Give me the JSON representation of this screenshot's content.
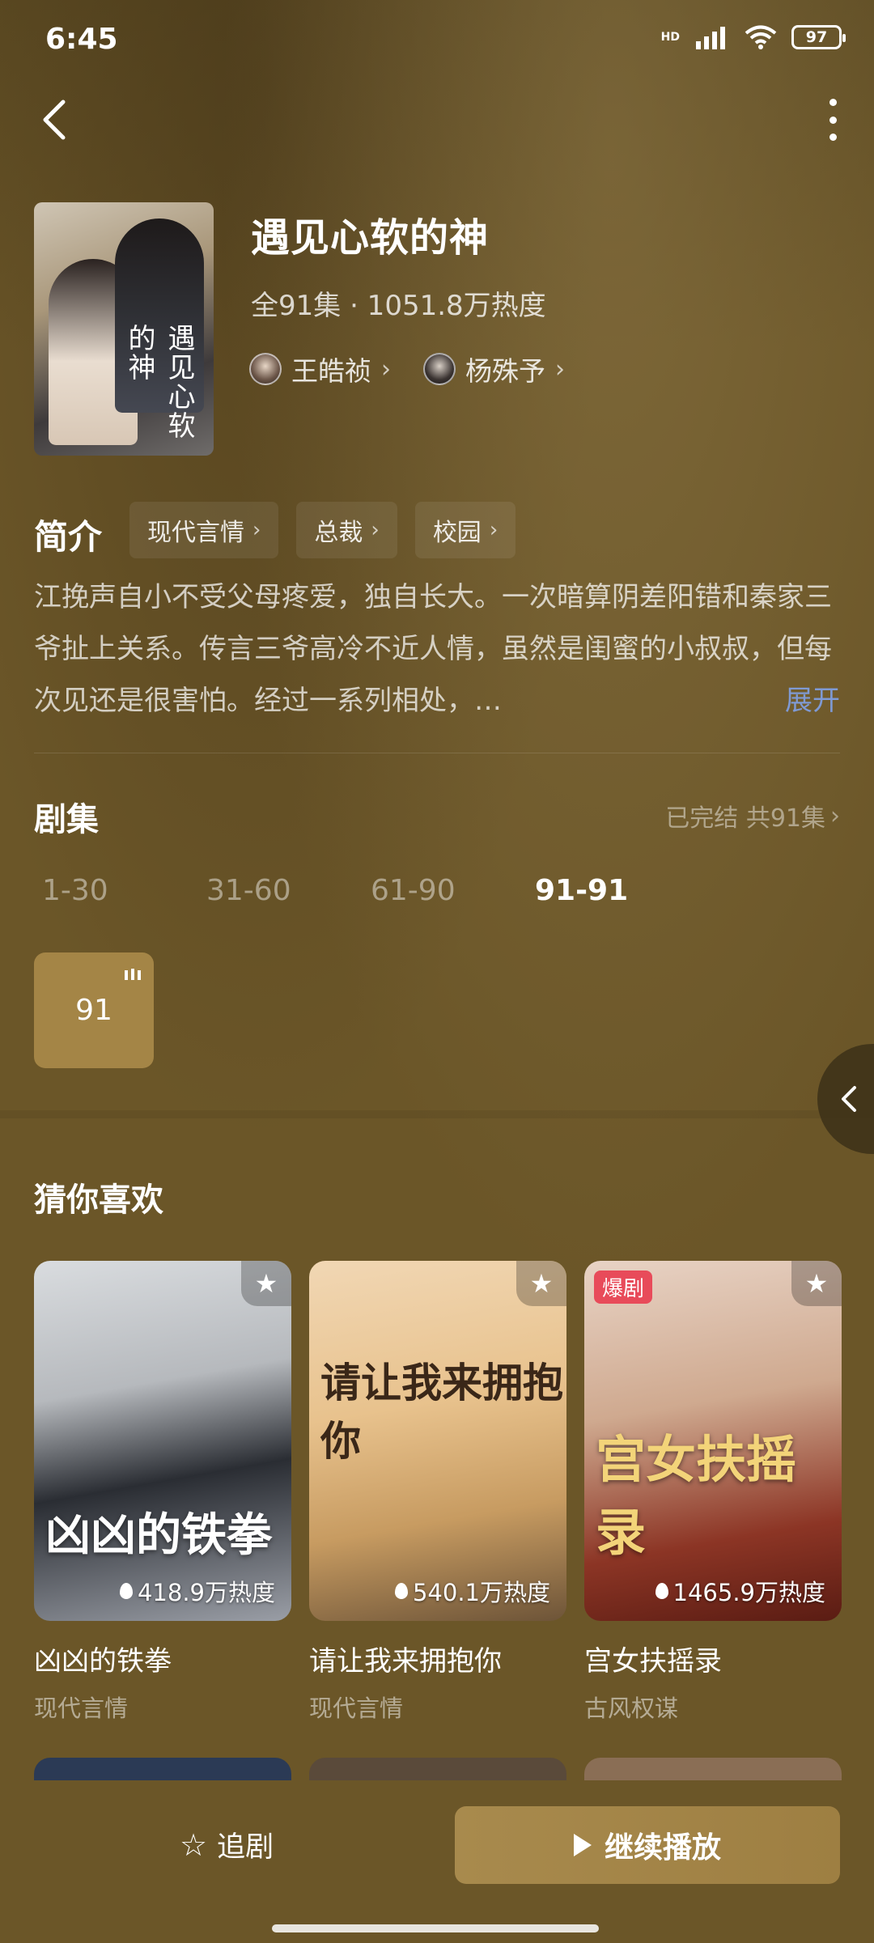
{
  "status_bar": {
    "time": "6:45",
    "network": "HD",
    "battery": "97"
  },
  "drama": {
    "title": "遇见心软的神",
    "meta": "全91集 · 1051.8万热度",
    "actors": [
      {
        "name": "王皓祯"
      },
      {
        "name": "杨殊予"
      }
    ]
  },
  "intro": {
    "heading": "简介",
    "tags": [
      "现代言情",
      "总裁",
      "校园"
    ],
    "description": "江挽声自小不受父母疼爱，独自长大。一次暗算阴差阳错和秦家三爷扯上关系。传言三爷高冷不近人情，虽然是闺蜜的小叔叔，但每次见还是很害怕。经过一系列相处，…",
    "expand_label": "展开"
  },
  "episodes": {
    "heading": "剧集",
    "status": "已完结 共91集",
    "ranges": [
      "1-30",
      "31-60",
      "61-90",
      "91-91"
    ],
    "active_range": "91-91",
    "current": "91"
  },
  "recommend": {
    "heading": "猜你喜欢",
    "items": [
      {
        "name": "凶凶的铁拳",
        "genre": "现代言情",
        "heat": "418.9万热度",
        "cover_text": "凶凶的铁拳",
        "badge": ""
      },
      {
        "name": "请让我来拥抱你",
        "genre": "现代言情",
        "heat": "540.1万热度",
        "cover_text": "请让我来拥抱你",
        "badge": ""
      },
      {
        "name": "宫女扶摇录",
        "genre": "古风权谋",
        "heat": "1465.9万热度",
        "cover_text": "宫女扶摇录",
        "badge": "爆剧"
      }
    ]
  },
  "bottom": {
    "follow_label": "追剧",
    "play_label": "继续播放"
  },
  "colors": {
    "background": "#6b5628",
    "accent": "#a48546",
    "expand": "#7f9ad4",
    "badge": "#e84b5a"
  },
  "icons": {
    "back": "chevron-left-icon",
    "more": "more-vertical-icon",
    "favorite": "star-icon",
    "play": "play-icon",
    "heat": "flame-icon"
  }
}
